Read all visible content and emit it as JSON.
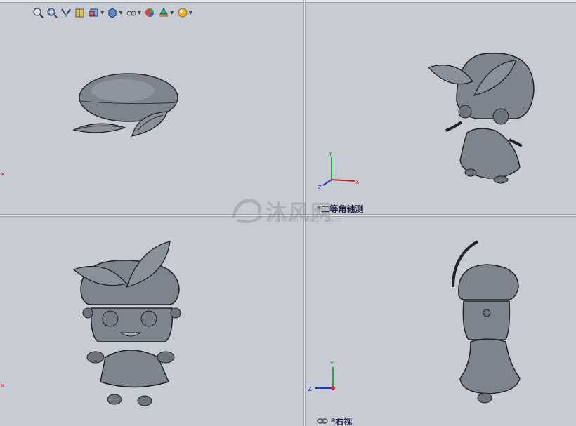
{
  "toolbar": {
    "icons": [
      "zoom-to-fit-icon",
      "zoom-to-area-icon",
      "previous-view-icon",
      "section-view-icon",
      "view-orientation-icon",
      "display-style-icon",
      "hide-show-items-icon",
      "edit-appearance-icon",
      "apply-scene-icon",
      "view-settings-icon"
    ]
  },
  "viewports": {
    "top_left": {
      "label": ""
    },
    "top_right": {
      "label": "*二等角轴测",
      "prefix": ""
    },
    "bottom_left": {
      "label": ""
    },
    "bottom_right": {
      "label": "*右视"
    }
  },
  "triad": {
    "x": "X",
    "y": "Y",
    "z": "Z"
  },
  "watermark": {
    "brand": "沐风网",
    "url": "www.mfcad.com"
  },
  "colors": {
    "background": "#c7ccd4",
    "model": "#8a8f98",
    "axis_x": "#cc2222",
    "axis_y": "#22aa33",
    "axis_z": "#2233cc"
  }
}
